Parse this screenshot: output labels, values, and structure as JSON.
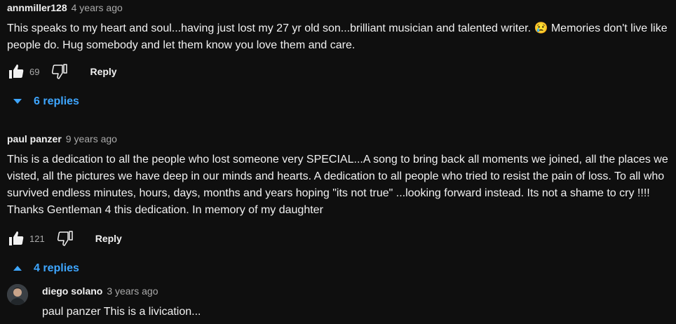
{
  "comments": [
    {
      "author": "annmiller128",
      "time": "4 years ago",
      "text": "This speaks to my heart and soul...having just lost my 27 yr old son...brilliant musician and talented writer. 😢 Memories don't live like people do. Hug somebody and let them know you love them and care.",
      "likes": "69",
      "reply_label": "Reply",
      "replies_label": "6 replies",
      "replies_expanded": false
    },
    {
      "author": "paul panzer",
      "time": "9 years ago",
      "text": "This is a dedication to all the people who lost someone very SPECIAL...A song to bring back all moments we joined, all the places we visted, all the pictures we have deep in our minds and hearts. A dedication to all people who tried to resist the pain of loss. To all who survived endless minutes, hours, days, months and years hoping \"its not true\" ...looking forward instead. Its not a shame to cry !!!! Thanks Gentleman 4 this dedication.     In memory of my daughter",
      "likes": "121",
      "reply_label": "Reply",
      "replies_label": "4 replies",
      "replies_expanded": true,
      "replies": [
        {
          "author": "diego solano",
          "time": "3 years ago",
          "text": "paul panzer This is a livication..."
        }
      ]
    }
  ],
  "icons": {
    "like": "thumbs-up-icon",
    "dislike": "thumbs-down-icon",
    "expand": "caret-down-icon",
    "collapse": "caret-up-icon"
  },
  "colors": {
    "background": "#0f0f0f",
    "text": "#f1f1f1",
    "secondary": "#aaaaaa",
    "link": "#3ea6ff"
  }
}
